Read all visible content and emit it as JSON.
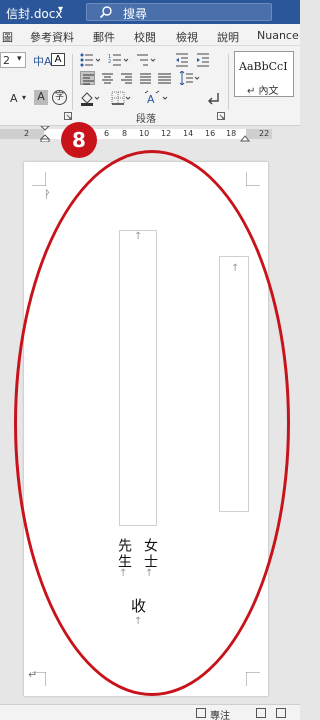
{
  "app": {
    "doc_title": "信封.docx",
    "search_placeholder": "搜尋"
  },
  "tabs": [
    "圖",
    "參考資料",
    "郵件",
    "校閱",
    "檢視",
    "說明",
    "Nuance"
  ],
  "ribbon": {
    "paragraph_group_label": "段落",
    "style_sample": "AaBbCcI",
    "style_name": "↵ 內文",
    "left_partial_value": "2"
  },
  "ruler": {
    "ticks": [
      "2",
      "6",
      "8",
      "10",
      "12",
      "14",
      "16",
      "18",
      "22"
    ]
  },
  "annotation": {
    "step_number": "8"
  },
  "envelope": {
    "mr_text": "先生",
    "ms_text": "女士",
    "receive_text": "收"
  },
  "status": {
    "focus_label": "專注"
  }
}
